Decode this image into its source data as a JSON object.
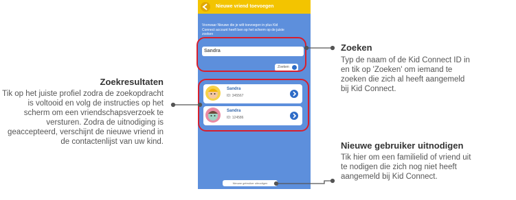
{
  "phone": {
    "header_title": "Nieuwe vriend toevoegen",
    "instructions": "Voorwaar Nieuwe die je wilt toevoegen in plus Kid Connect account heeft ben op het scherm op de juiste zoeken",
    "search_value": "Sandra",
    "search_button": "Zoeken",
    "results": [
      {
        "name": "Sandra",
        "id": "ID: 345567"
      },
      {
        "name": "Sandra",
        "id": "ID: 124586"
      }
    ],
    "invite_button": "Nieuwe gebruiker uitnodigen"
  },
  "callouts": {
    "zoeken": {
      "title": "Zoeken",
      "body": "Typ de naam of de Kid Connect ID in en tik op 'Zoeken' om iemand te zoeken die zich al heeft aangemeld bij Kid Connect."
    },
    "zoekresultaten": {
      "title": "Zoekresultaten",
      "body": "Tik op het juiste profiel zodra de zoekopdracht is voltooid en volg de instructies op het scherm om een vriendschapsverzoek te versturen. Zodra de uitnodiging is geaccepteerd, verschijnt de nieuwe vriend in de contactenlijst van uw kind."
    },
    "uitnodigen": {
      "title": "Nieuwe gebruiker uitnodigen",
      "body": "Tik hier om een familielid of vriend uit te nodigen die zich nog niet heeft aangemeld bij Kid Connect."
    }
  },
  "colors": {
    "header": "#f3c400",
    "screen": "#5d8fdc",
    "highlight": "#d81e2c",
    "add_button": "#2e6cc7"
  }
}
